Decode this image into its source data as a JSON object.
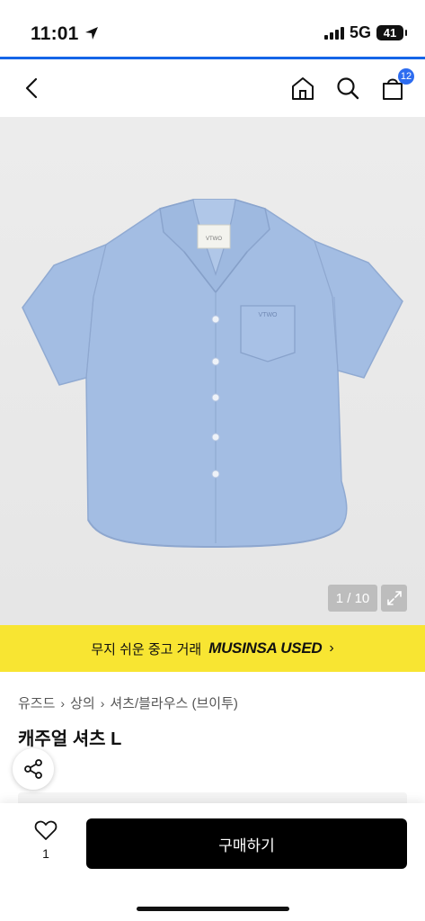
{
  "status_bar": {
    "time": "11:01",
    "network": "5G",
    "battery": "41"
  },
  "page_load_progress": 1.0,
  "nav": {
    "cart_count": "12"
  },
  "product_image": {
    "description_icons": [
      "shirt-illustration"
    ],
    "label_on_shirt": "VTWO",
    "counter": "1 / 10"
  },
  "banner": {
    "text": "무지 쉬운 중고 거래",
    "brand": "MUSINSA USED",
    "chevron": "›"
  },
  "breadcrumb": {
    "items": [
      "유즈드",
      "상의",
      "셔츠/블라우스 (브이투)"
    ],
    "separator": "›"
  },
  "product": {
    "title": "캐주얼 셔츠 L"
  },
  "bottom_bar": {
    "like_count": "1",
    "buy_label": "구매하기"
  },
  "colors": {
    "banner_bg": "#f8e532",
    "accent_blue": "#2d6cf0",
    "buy_button_bg": "#000000"
  }
}
